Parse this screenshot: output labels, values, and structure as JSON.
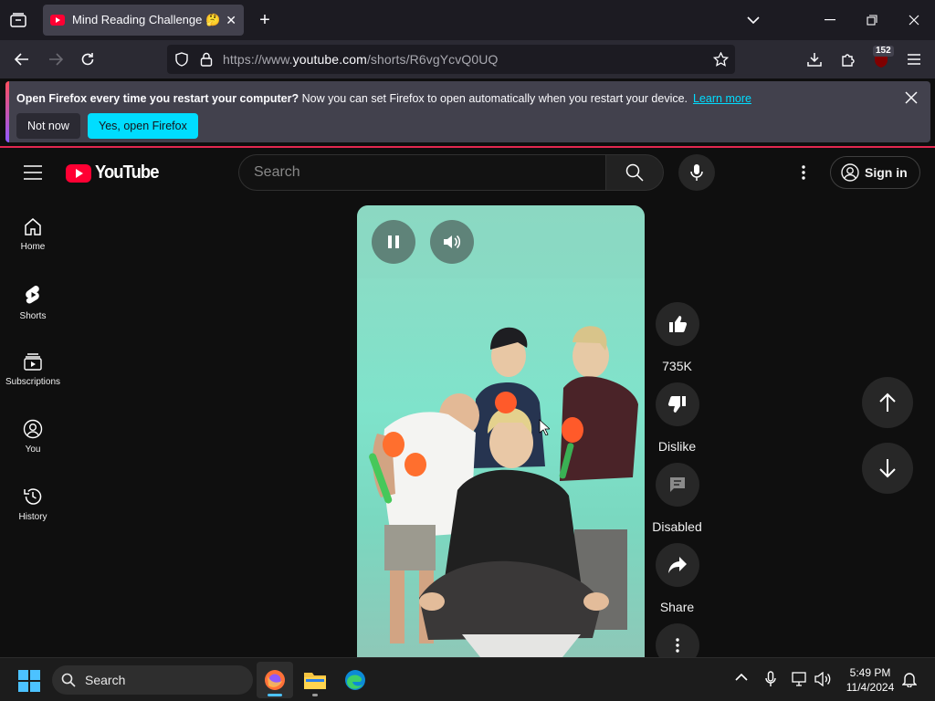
{
  "browser": {
    "tab_title": "Mind Reading Challenge 🤔 #lo",
    "url_scheme": "https://www.",
    "url_domain": "youtube.com",
    "url_path": "/shorts/R6vgYcvQ0UQ",
    "extensions_badge": "152"
  },
  "notification": {
    "bold_text": "Open Firefox every time you restart your computer?",
    "body_text": " Now you can set Firefox to open automatically when you restart your device.",
    "link_label": "Learn more",
    "not_now_label": "Not now",
    "yes_label": "Yes, open Firefox"
  },
  "youtube": {
    "logo_text": "YouTube",
    "search_placeholder": "Search",
    "sign_in_label": "Sign in",
    "nav": [
      {
        "label": "Home",
        "icon": "home-icon"
      },
      {
        "label": "Shorts",
        "icon": "shorts-icon"
      },
      {
        "label": "Subscriptions",
        "icon": "subscriptions-icon"
      },
      {
        "label": "You",
        "icon": "you-icon"
      },
      {
        "label": "History",
        "icon": "history-icon"
      }
    ],
    "actions": {
      "like_count": "735K",
      "dislike_label": "Dislike",
      "comments_label": "Disabled",
      "share_label": "Share"
    }
  },
  "taskbar": {
    "search_label": "Search",
    "time": "5:49 PM",
    "date": "11/4/2024"
  },
  "colors": {
    "youtube_red": "#ff0033",
    "firefox_accent": "#00ddff",
    "video_bg": "#7fe3cb"
  }
}
